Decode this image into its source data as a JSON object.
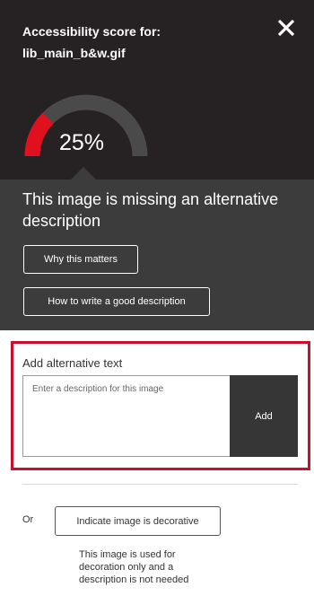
{
  "panel": {
    "title_line1": "Accessibility score for:",
    "title_line2": "lib_main_b&w.gif",
    "close_icon": "close-icon"
  },
  "score": {
    "value_percent": 25,
    "label": "25%",
    "fill_color": "#e0101e",
    "track_color": "#4a4a4a"
  },
  "status": {
    "heading": "This image is missing an alternative description",
    "why_button": "Why this matters",
    "how_button": "How to write a good description"
  },
  "alt_text": {
    "label": "Add alternative text",
    "placeholder": "Enter a description for this image",
    "value": "",
    "add_button": "Add",
    "highlight_color": "#c8102e"
  },
  "decorative": {
    "or_label": "Or",
    "button_label": "Indicate image is decorative",
    "note": "This image is used for decoration only and a description is not needed"
  }
}
